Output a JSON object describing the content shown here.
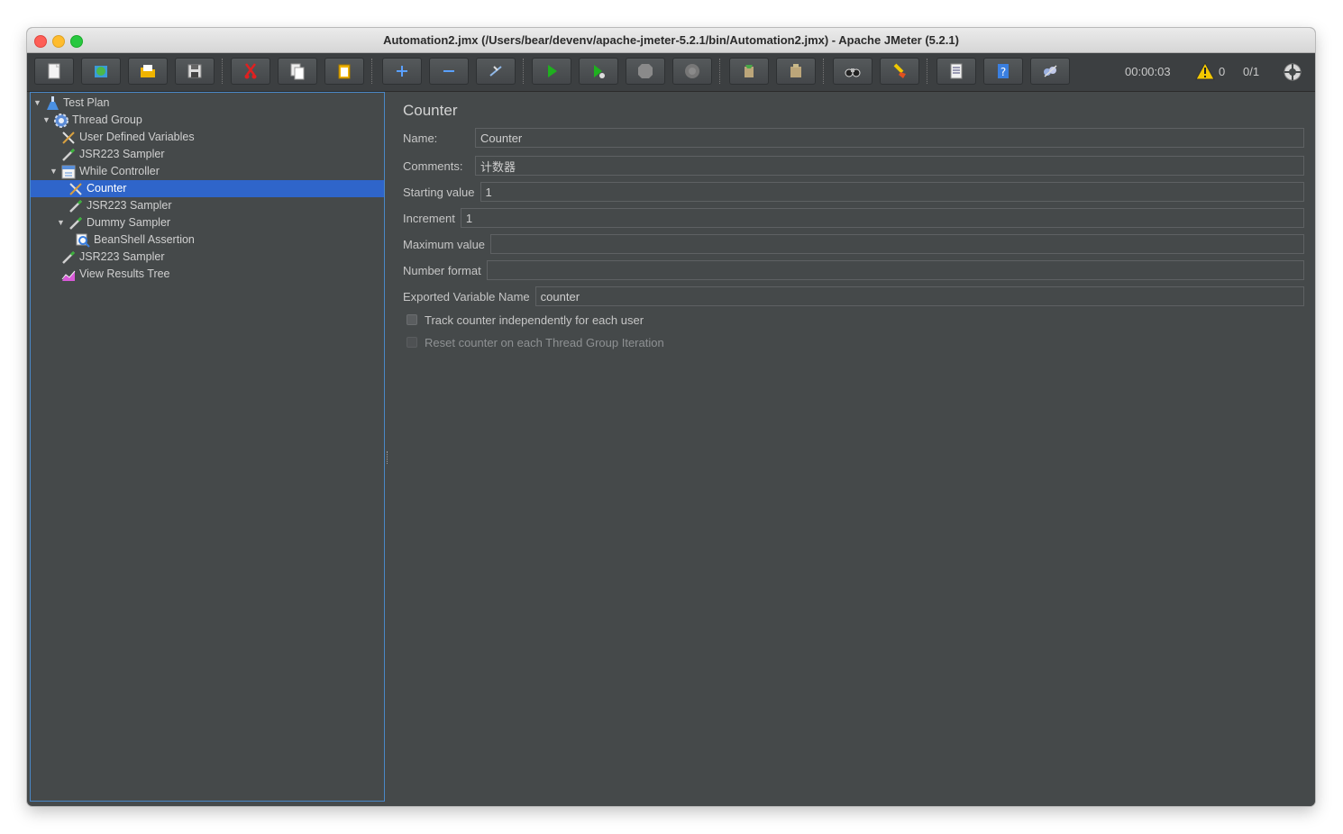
{
  "window": {
    "title": "Automation2.jmx (/Users/bear/devenv/apache-jmeter-5.2.1/bin/Automation2.jmx) - Apache JMeter (5.2.1)"
  },
  "toolbar": {
    "buttons": [
      {
        "name": "new-icon"
      },
      {
        "name": "templates-icon"
      },
      {
        "name": "open-icon"
      },
      {
        "name": "save-icon"
      },
      {
        "name": "cut-icon"
      },
      {
        "name": "copy-icon"
      },
      {
        "name": "paste-icon"
      },
      {
        "name": "expand-all-icon"
      },
      {
        "name": "collapse-all-icon"
      },
      {
        "name": "toggle-icon"
      },
      {
        "name": "start-icon"
      },
      {
        "name": "start-no-pauses-icon"
      },
      {
        "name": "stop-icon"
      },
      {
        "name": "shutdown-icon"
      },
      {
        "name": "clear-icon"
      },
      {
        "name": "clear-all-icon"
      },
      {
        "name": "search-icon"
      },
      {
        "name": "reset-search-icon"
      },
      {
        "name": "function-helper-icon"
      },
      {
        "name": "help-icon"
      },
      {
        "name": "remote-icon"
      }
    ],
    "timer": "00:00:03",
    "warnings": "0",
    "threads": "0/1"
  },
  "tree": {
    "items": [
      {
        "label": "Test Plan",
        "icon": "flask-icon",
        "expanded": true
      },
      {
        "label": "Thread Group",
        "icon": "gear-icon",
        "expanded": true
      },
      {
        "label": "User Defined Variables",
        "icon": "tools-icon"
      },
      {
        "label": "JSR223 Sampler",
        "icon": "pipette-icon"
      },
      {
        "label": "While Controller",
        "icon": "controller-icon",
        "expanded": true
      },
      {
        "label": "Counter",
        "icon": "tools-icon",
        "selected": true
      },
      {
        "label": "JSR223 Sampler",
        "icon": "pipette-icon"
      },
      {
        "label": "Dummy Sampler",
        "icon": "pipette-icon",
        "expanded": true
      },
      {
        "label": "BeanShell Assertion",
        "icon": "magnifier-icon"
      },
      {
        "label": "JSR223 Sampler",
        "icon": "pipette-icon"
      },
      {
        "label": "View Results Tree",
        "icon": "chart-icon"
      }
    ]
  },
  "panel": {
    "title": "Counter",
    "fields": {
      "name": {
        "label": "Name:",
        "value": "Counter"
      },
      "comments": {
        "label": "Comments:",
        "value": "计数器"
      },
      "start": {
        "label": "Starting value",
        "value": "1"
      },
      "increment": {
        "label": "Increment",
        "value": "1"
      },
      "maximum": {
        "label": "Maximum value",
        "value": ""
      },
      "format": {
        "label": "Number format",
        "value": ""
      },
      "varname": {
        "label": "Exported Variable Name",
        "value": "counter"
      }
    },
    "checkboxes": {
      "track": {
        "label": "Track counter independently for each user",
        "checked": false
      },
      "reset": {
        "label": "Reset counter on each Thread Group Iteration",
        "checked": false,
        "disabled": true
      }
    }
  }
}
